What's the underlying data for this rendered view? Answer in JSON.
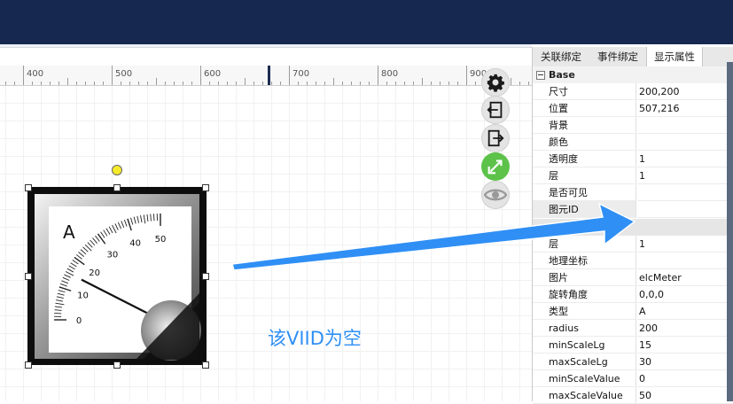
{
  "ruler": {
    "labels": [
      "400",
      "500",
      "600",
      "700",
      "800",
      "900"
    ]
  },
  "tools": {
    "settings_icon": "gear-icon",
    "import_icon": "import-icon",
    "export_icon": "export-icon",
    "green_icon": "arrow-in-icon",
    "eye_icon": "eye-icon"
  },
  "meter": {
    "unit_label": "A",
    "scale_labels": [
      "0",
      "10",
      "20",
      "30",
      "40",
      "50"
    ],
    "needle_value": 15
  },
  "annotation": {
    "text": "该VIID为空",
    "color": "#2f8ff5"
  },
  "panel": {
    "tabs": [
      "关联绑定",
      "事件绑定",
      "显示属性"
    ],
    "active_tab": 2,
    "group_title": "Base",
    "rows_a": [
      {
        "key": "尺寸",
        "value": "200,200"
      },
      {
        "key": "位置",
        "value": "507,216"
      },
      {
        "key": "背景",
        "value": ""
      },
      {
        "key": "颜色",
        "value": ""
      },
      {
        "key": "透明度",
        "value": "1"
      },
      {
        "key": "层",
        "value": "1"
      },
      {
        "key": "是否可见",
        "value": ""
      },
      {
        "key": "图元ID",
        "value": ""
      }
    ],
    "rows_b": [
      {
        "key": "层",
        "value": "1"
      },
      {
        "key": "地理坐标",
        "value": ""
      },
      {
        "key": "图片",
        "value": "elcMeter"
      },
      {
        "key": "旋转角度",
        "value": "0,0,0"
      },
      {
        "key": "类型",
        "value": "A"
      },
      {
        "key": "radius",
        "value": "200"
      },
      {
        "key": "minScaleLg",
        "value": "15"
      },
      {
        "key": "maxScaleLg",
        "value": "30"
      },
      {
        "key": "minScaleValue",
        "value": "0"
      },
      {
        "key": "maxScaleValue",
        "value": "50"
      }
    ],
    "visible_checked": true
  }
}
